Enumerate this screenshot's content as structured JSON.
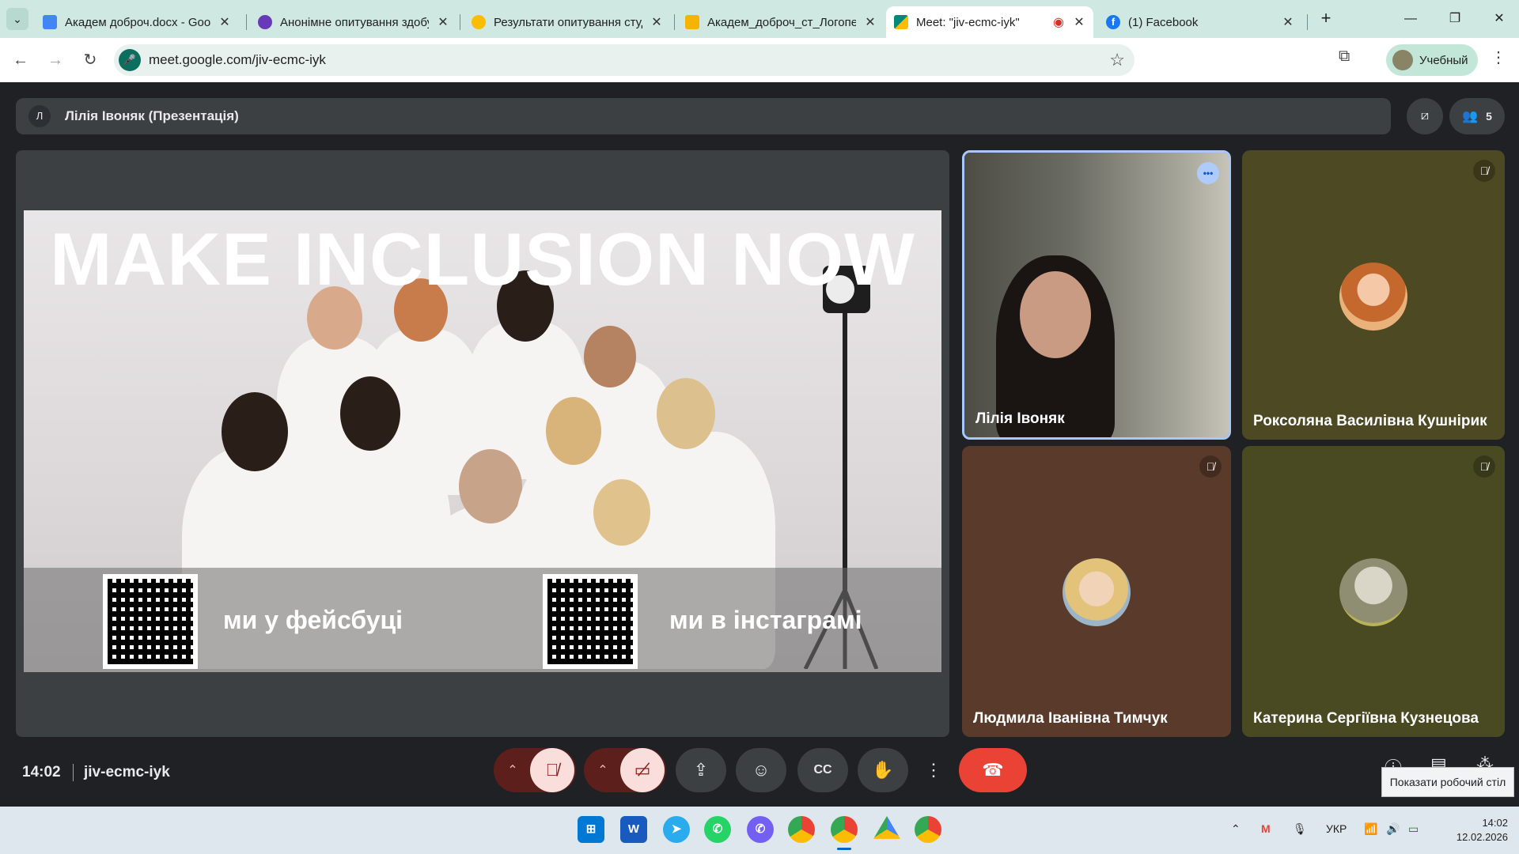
{
  "browser": {
    "tabs": [
      {
        "title": "Академ доброч.docx - Goog",
        "icon": "google-docs-icon",
        "color": "#4285f4"
      },
      {
        "title": "Анонімне опитування здобу",
        "icon": "google-forms-icon",
        "color": "#673ab7"
      },
      {
        "title": "Результати опитування студ",
        "icon": "google-slides-icon",
        "color": "#fbbc04"
      },
      {
        "title": "Академ_доброч_ст_Логопед",
        "icon": "google-slides-icon",
        "color": "#f4b400"
      },
      {
        "title": "Meet: \"jiv-ecmc-iyk\"",
        "icon": "google-meet-icon",
        "color": "#00897b",
        "active": true
      },
      {
        "title": "(1) Facebook",
        "icon": "facebook-icon",
        "color": "#1877f2"
      }
    ],
    "url": "meet.google.com/jiv-ecmc-iyk",
    "profile_label": "Учебный"
  },
  "meet": {
    "presenter_initial": "Л",
    "presentation_title": "Лілія Івоняк (Презентація)",
    "participants_count": "5",
    "slide": {
      "headline": "MAKE INCLUSION NOW",
      "qr_label_1": "ми у фейсбуці",
      "qr_label_2": "ми в інстаграмі"
    },
    "tiles": [
      {
        "name": "Лілія Івоняк",
        "speaking": true
      },
      {
        "name": "Роксоляна Василівна Кушнірик",
        "muted": true
      },
      {
        "name": "Людмила Іванівна Тимчук",
        "muted": true
      },
      {
        "name": "Катерина Сергіївна Кузнецова",
        "muted": true
      }
    ],
    "time": "14:02",
    "meeting_code": "jiv-ecmc-iyk",
    "tooltip": "Показати робочий стіл"
  },
  "taskbar": {
    "language": "УКР",
    "clock_time": "14:02",
    "clock_date": "12.02.2026"
  },
  "colors": {
    "meet_bg": "#202124",
    "end_call": "#ea4335",
    "muted_control": "#f9dedc",
    "chrome_tabbar": "#cfe8e1"
  }
}
